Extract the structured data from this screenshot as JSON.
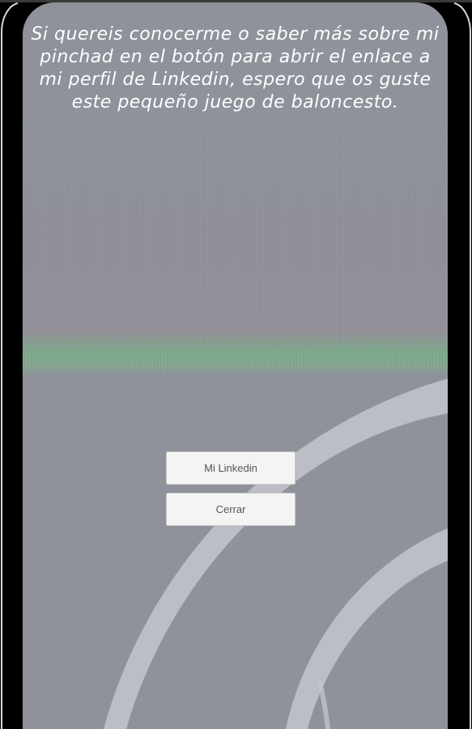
{
  "intro_message": "Si quereis conocerme o saber más sobre mi pinchad en el botón para abrir el enlace a mi perfil de Linkedin, espero que os guste este pequeño juego de baloncesto.",
  "buttons": {
    "linkedin_label": "Mi Linkedin",
    "close_label": "Cerrar"
  },
  "colors": {
    "background": "#000000",
    "court": "#8f929b",
    "court_lines": "#c4c6cd",
    "text": "#ffffff",
    "button_bg": "#f4f4f4",
    "button_text": "#555555"
  }
}
